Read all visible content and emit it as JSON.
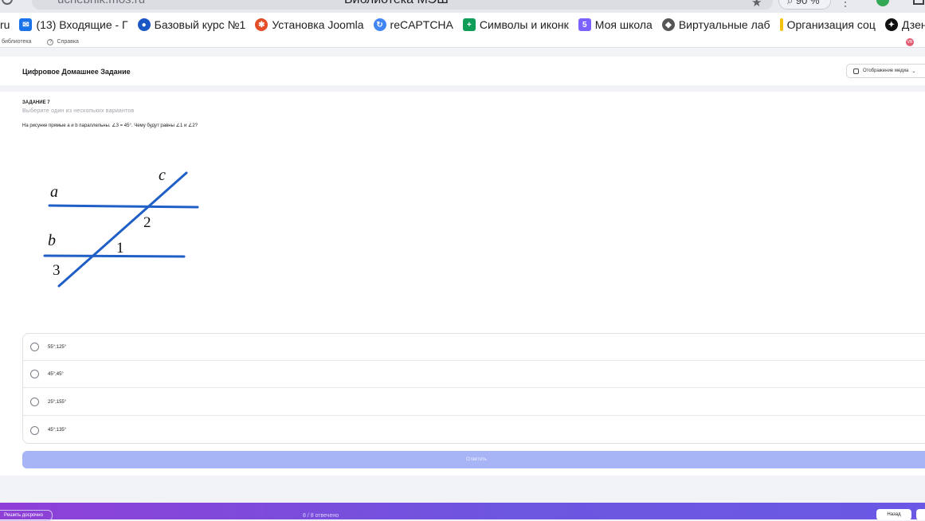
{
  "browser": {
    "url": "uchebnik.mos.ru",
    "tab_title": "Библиотека МЭШ",
    "zoom": "90 %"
  },
  "bookmarks": [
    {
      "label": "ru",
      "icon": "none",
      "color": "#ffffff"
    },
    {
      "label": "(13) Входящие - Г",
      "icon": "mail-icon",
      "color": "#1a73e8"
    },
    {
      "label": "Базовый курс №1",
      "icon": "globe-icon",
      "color": "#1a56c4"
    },
    {
      "label": "Установка Joomla",
      "icon": "joomla-icon",
      "color": "#e44d26"
    },
    {
      "label": "reCAPTCHA",
      "icon": "recaptcha-icon",
      "color": "#4285f4"
    },
    {
      "label": "Символы и иконк",
      "icon": "plus-square-icon",
      "color": "#0f9d58"
    },
    {
      "label": "Моя школа",
      "icon": "school-icon",
      "color": "#7b61ff"
    },
    {
      "label": "Виртуальные лаб",
      "icon": "lab-icon",
      "color": "#555555"
    },
    {
      "label": "Организация соц",
      "icon": "bar-icon",
      "color": "#f4c20d"
    },
    {
      "label": "Дзен — глав",
      "icon": "zen-icon",
      "color": "#111111"
    }
  ],
  "subbar": {
    "library": "библиотека",
    "help": "Справка",
    "avatar": "VB"
  },
  "header": {
    "title": "Цифровое Домашнее Задание",
    "media_toggle": "Отображение медиа"
  },
  "task": {
    "number": "ЗАДАНИЕ 7",
    "hint": "Выберите один из нескольких вариантов",
    "question": "На рисунке прямые  a  и  b  параллельны.  ∠3 = 45°.  Чему будут равны  ∠1  и  ∠2?",
    "figure": {
      "label_a": "a",
      "label_b": "b",
      "label_c": "c",
      "label_1": "1",
      "label_2": "2",
      "label_3": "3",
      "line_color": "#1f5fc6"
    },
    "options": [
      {
        "label": "55°;125°"
      },
      {
        "label": "45°;45°"
      },
      {
        "label": "25°;155°"
      },
      {
        "label": "45°;135°"
      }
    ],
    "submit_label": "Ответить"
  },
  "footer": {
    "left_button": "Решить досрочно",
    "progress": "8 / 8 отвечено",
    "next_button": "Назад"
  }
}
